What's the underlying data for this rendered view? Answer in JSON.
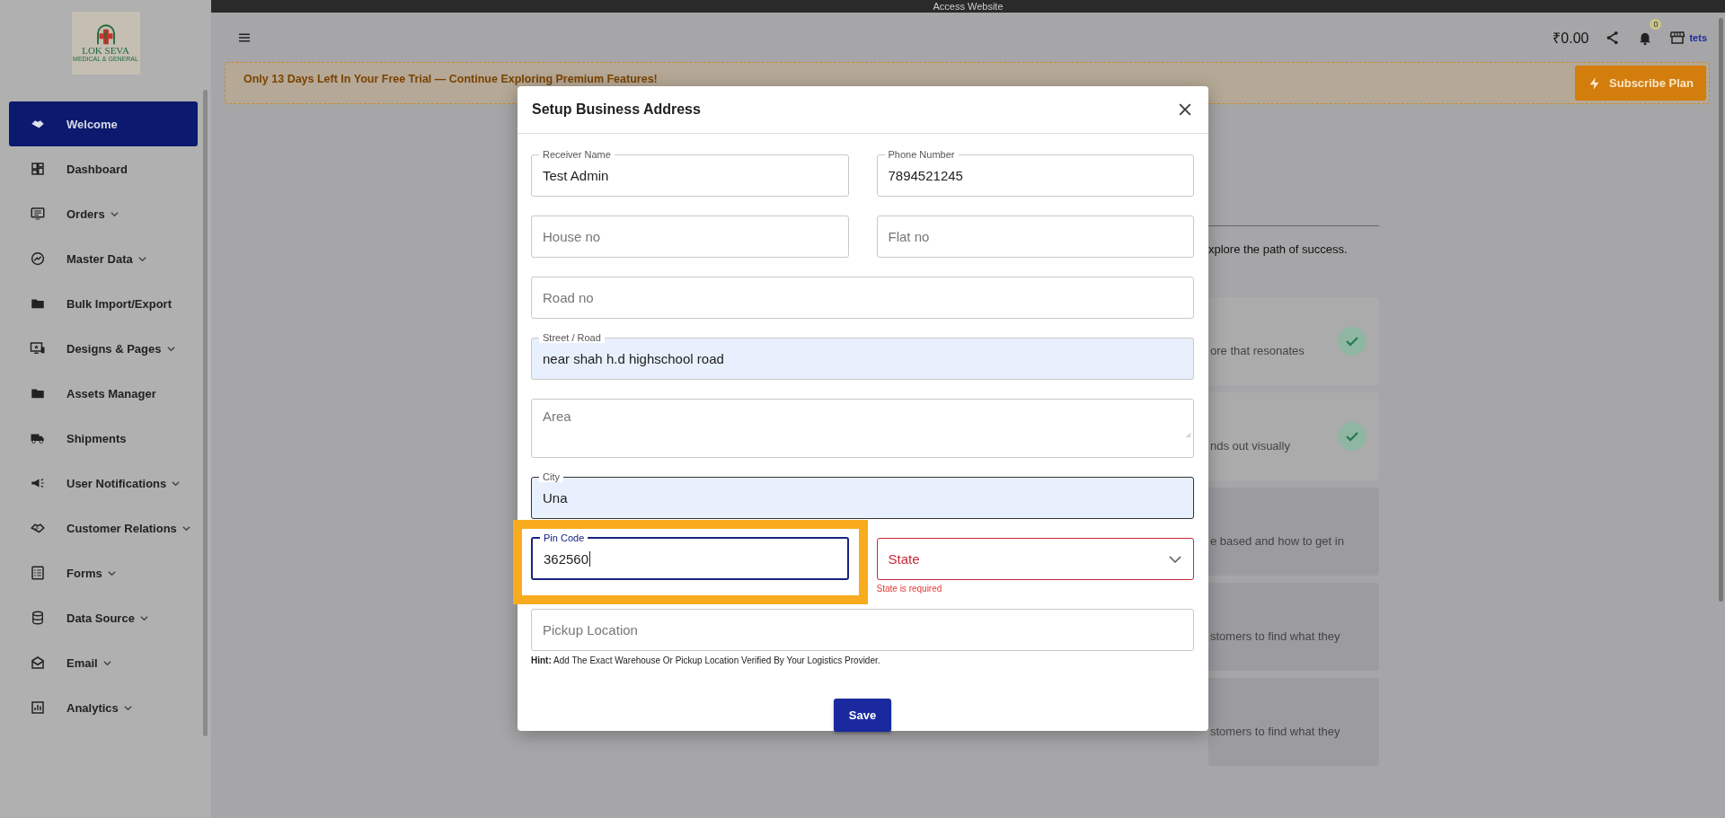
{
  "top_bar": {
    "title": "Access Website"
  },
  "sidebar": {
    "logo": {
      "name": "LOK SEVA",
      "tagline": "MEDICAL & GENERAL"
    },
    "items": [
      {
        "label": "Welcome",
        "selected": true,
        "expandable": false
      },
      {
        "label": "Dashboard",
        "selected": false,
        "expandable": false
      },
      {
        "label": "Orders",
        "selected": false,
        "expandable": true
      },
      {
        "label": "Master Data",
        "selected": false,
        "expandable": true
      },
      {
        "label": "Bulk Import/Export",
        "selected": false,
        "expandable": false
      },
      {
        "label": "Designs & Pages",
        "selected": false,
        "expandable": true
      },
      {
        "label": "Assets Manager",
        "selected": false,
        "expandable": false
      },
      {
        "label": "Shipments",
        "selected": false,
        "expandable": false
      },
      {
        "label": "User Notifications",
        "selected": false,
        "expandable": true
      },
      {
        "label": "Customer Relations",
        "selected": false,
        "expandable": true
      },
      {
        "label": "Forms",
        "selected": false,
        "expandable": true
      },
      {
        "label": "Data Source",
        "selected": false,
        "expandable": true
      },
      {
        "label": "Email",
        "selected": false,
        "expandable": true
      },
      {
        "label": "Analytics",
        "selected": false,
        "expandable": true
      }
    ]
  },
  "header": {
    "balance": "₹0.00",
    "notification_count": "0",
    "store_label": "tets"
  },
  "trial_banner": {
    "text": "Only 13 Days Left In Your Free Trial — Continue Exploring Premium Features!",
    "button": "Subscribe Plan"
  },
  "background": {
    "intro": "xplore the path of success.",
    "steps": [
      {
        "text": "ore that resonates",
        "done": true
      },
      {
        "text": "nds out visually",
        "done": true
      },
      {
        "text": "e based and how to get in",
        "done": false
      },
      {
        "text": "stomers to find what they",
        "done": false
      },
      {
        "text": "stomers to find what they",
        "done": false
      }
    ]
  },
  "modal": {
    "title": "Setup Business Address",
    "rows": [
      [
        {
          "kind": "input",
          "label": "Receiver Name",
          "value": "Test Admin",
          "autofilled": false,
          "focused": false
        },
        {
          "kind": "input",
          "label": "Phone Number",
          "value": "7894521245",
          "autofilled": false,
          "focused": false
        }
      ],
      [
        {
          "kind": "input",
          "placeholder": "House no",
          "autofilled": false,
          "focused": false
        },
        {
          "kind": "input",
          "placeholder": "Flat no",
          "autofilled": false,
          "focused": false
        }
      ],
      [
        {
          "kind": "input",
          "placeholder": "Road no",
          "autofilled": false,
          "focused": false
        }
      ],
      [
        {
          "kind": "input",
          "label": "Street / Road",
          "value": "near shah h.d highschool road",
          "autofilled": true,
          "focused": false
        }
      ],
      [
        {
          "kind": "textarea",
          "placeholder": "Area",
          "autofilled": false,
          "focused": false
        }
      ],
      [
        {
          "kind": "input",
          "label": "City",
          "value": "Una",
          "autofilled": true,
          "focused": false
        }
      ],
      [
        {
          "kind": "input",
          "label": "Pin Code",
          "value": "362560",
          "autofilled": false,
          "focused": true,
          "highlighted": true
        },
        {
          "kind": "select",
          "placeholder": "State",
          "error": "State is required",
          "autofilled": false,
          "focused": false
        }
      ],
      [
        {
          "kind": "input",
          "placeholder": "Pickup Location",
          "autofilled": false,
          "focused": false
        }
      ]
    ],
    "hint": "**Hint:** Add The Exact Warehouse Or Pickup Location Verified By Your Logistics Provider.",
    "save": "Save"
  }
}
